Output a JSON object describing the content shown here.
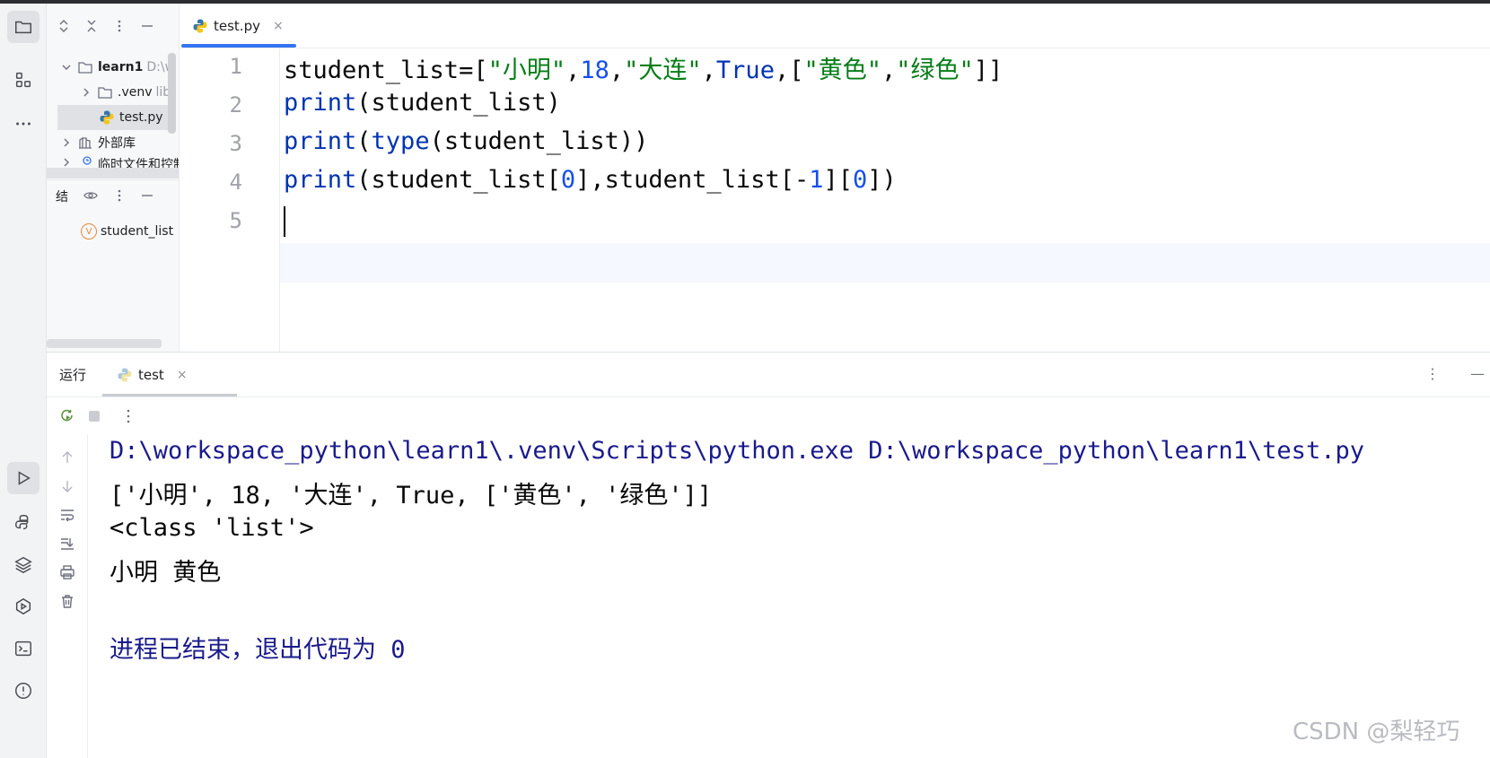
{
  "editor": {
    "tab_label": "test.py",
    "tab_close": "×",
    "line_numbers": [
      "1",
      "2",
      "3",
      "4",
      "5"
    ],
    "lines": [
      [
        {
          "t": "student_list=[",
          "c": ""
        },
        {
          "t": "\"小明\"",
          "c": "str"
        },
        {
          "t": ",",
          "c": ""
        },
        {
          "t": "18",
          "c": "num"
        },
        {
          "t": ",",
          "c": ""
        },
        {
          "t": "\"大连\"",
          "c": "str"
        },
        {
          "t": ",",
          "c": ""
        },
        {
          "t": "True",
          "c": "kw"
        },
        {
          "t": ",[",
          "c": ""
        },
        {
          "t": "\"黄色\"",
          "c": "str"
        },
        {
          "t": ",",
          "c": ""
        },
        {
          "t": "\"绿色\"",
          "c": "str"
        },
        {
          "t": "]]",
          "c": ""
        }
      ],
      [
        {
          "t": "print",
          "c": "kw"
        },
        {
          "t": "(student_list)",
          "c": ""
        }
      ],
      [
        {
          "t": "print",
          "c": "kw"
        },
        {
          "t": "(",
          "c": ""
        },
        {
          "t": "type",
          "c": "kw"
        },
        {
          "t": "(student_list))",
          "c": ""
        }
      ],
      [
        {
          "t": "print",
          "c": "kw"
        },
        {
          "t": "(student_list[",
          "c": ""
        },
        {
          "t": "0",
          "c": "num"
        },
        {
          "t": "],student_list[-",
          "c": ""
        },
        {
          "t": "1",
          "c": "num"
        },
        {
          "t": "][",
          "c": ""
        },
        {
          "t": "0",
          "c": "num"
        },
        {
          "t": "])",
          "c": ""
        }
      ],
      []
    ]
  },
  "project": {
    "items": [
      {
        "label": "learn1",
        "suffix": "D:\\w",
        "bold": true
      },
      {
        "label": ".venv",
        "suffix": "lib"
      },
      {
        "label": "test.py",
        "selected": true
      },
      {
        "label": "外部库"
      },
      {
        "label": "临时文件和控制台"
      }
    ],
    "structure_label": "结",
    "structure_item": "student_list",
    "structure_badge": "V"
  },
  "run": {
    "title": "运行",
    "tab_label": "test",
    "tab_close": "×",
    "more": "⋮",
    "minimize": "—",
    "console": [
      {
        "text": "D:\\workspace_python\\learn1\\.venv\\Scripts\\python.exe D:\\workspace_python\\learn1\\test.py",
        "kind": "cmd"
      },
      {
        "text": "['小明', 18, '大连', True, ['黄色', '绿色']]",
        "kind": "out"
      },
      {
        "text": "<class 'list'>",
        "kind": "out"
      },
      {
        "text": "小明 黄色",
        "kind": "out"
      },
      {
        "text": "",
        "kind": "out"
      },
      {
        "text": "进程已结束，退出代码为 0",
        "kind": "exit"
      }
    ]
  },
  "watermark": "CSDN @梨轻巧",
  "colors": {
    "accent": "#3574f0",
    "keyword": "#0033b3",
    "string": "#067d17",
    "number": "#1750eb"
  }
}
